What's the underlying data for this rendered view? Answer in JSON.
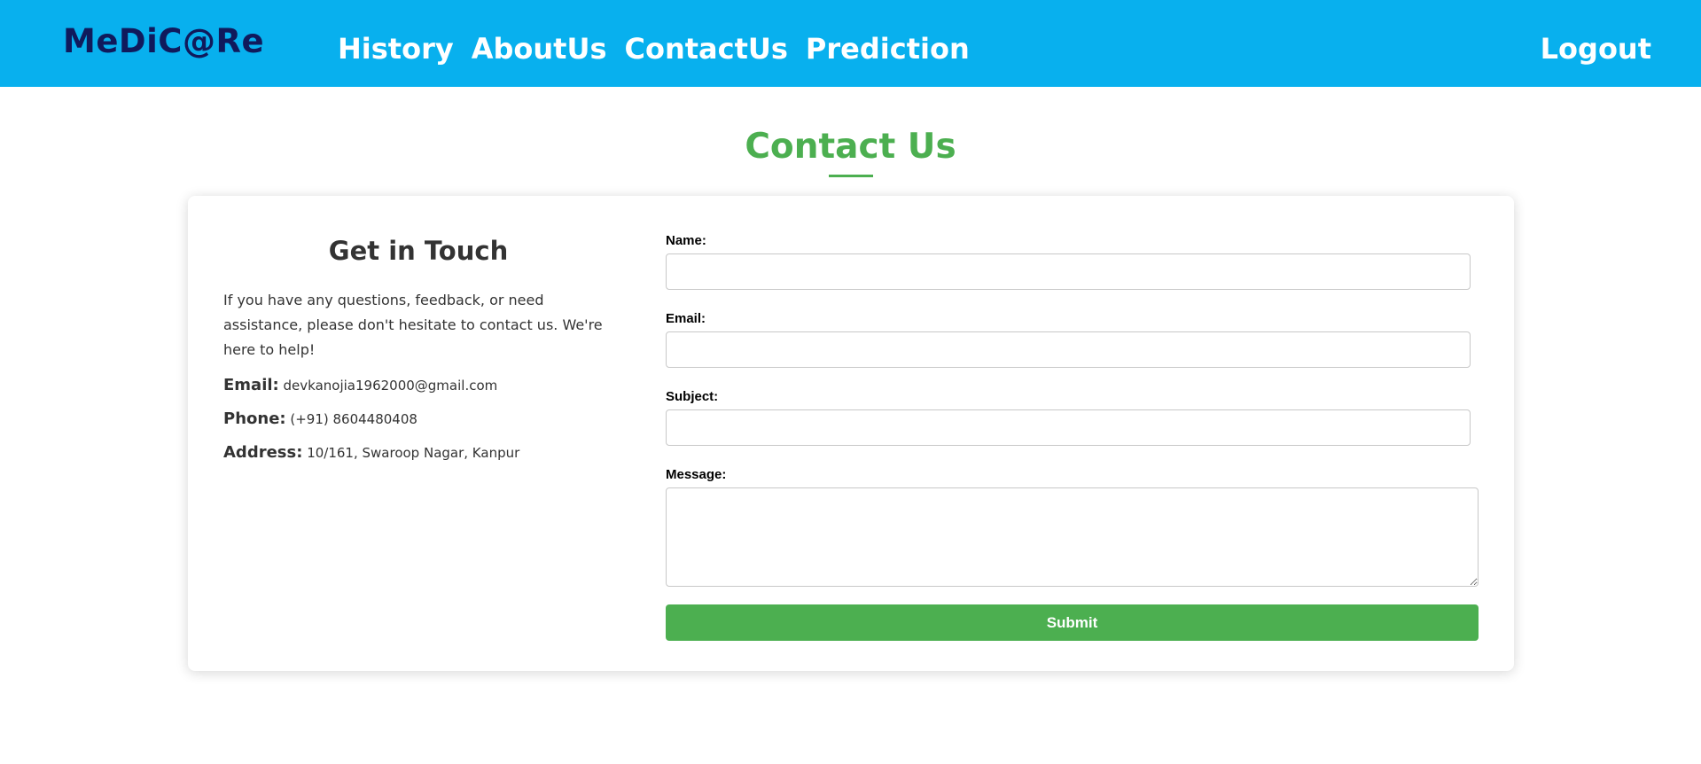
{
  "colors": {
    "navbar_bg": "#08b0ee",
    "brand_text": "#101a5c",
    "accent_green": "#4caf50",
    "nav_text": "#ffffff"
  },
  "navbar": {
    "brand": "MeDiC@Re",
    "links": [
      {
        "label": "History"
      },
      {
        "label": "AboutUs"
      },
      {
        "label": "ContactUs"
      },
      {
        "label": "Prediction"
      }
    ],
    "logout_label": "Logout"
  },
  "page": {
    "title": "Contact Us"
  },
  "contact_info": {
    "heading": "Get in Touch",
    "description": "If you have any questions, feedback, or need assistance, please don't hesitate to contact us. We're here to help!",
    "email_label": "Email:",
    "email_value": "devkanojia1962000@gmail.com",
    "phone_label": "Phone:",
    "phone_value": "(+91) 8604480408",
    "address_label": "Address:",
    "address_value": "10/161, Swaroop Nagar, Kanpur"
  },
  "form": {
    "name_label": "Name:",
    "name_value": "",
    "email_label": "Email:",
    "email_value": "",
    "subject_label": "Subject:",
    "subject_value": "",
    "message_label": "Message:",
    "message_value": "",
    "submit_label": "Submit"
  }
}
